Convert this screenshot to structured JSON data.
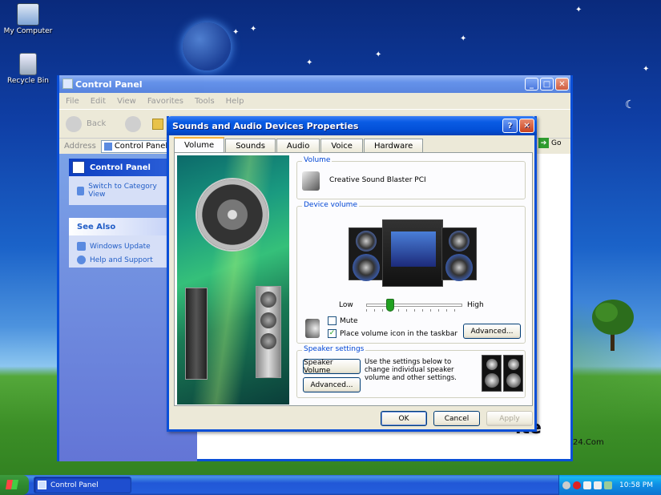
{
  "desktop": {
    "icons": [
      {
        "label": "My Computer"
      },
      {
        "label": "Recycle Bin"
      }
    ],
    "watermark": "ite",
    "watermark_sub": "24.Com"
  },
  "control_panel": {
    "title": "Control Panel",
    "menu": [
      "File",
      "Edit",
      "View",
      "Favorites",
      "Tools",
      "Help"
    ],
    "back_label": "Back",
    "address_label": "Address",
    "address_value": "Control Panel",
    "go_label": "Go",
    "left_panel": {
      "header": "Control Panel",
      "switch_link": "Switch to Category View",
      "see_also_header": "See Also",
      "links": [
        "Windows Update",
        "Help and Support"
      ]
    }
  },
  "dialog": {
    "title": "Sounds and Audio Devices Properties",
    "tabs": [
      "Volume",
      "Sounds",
      "Audio",
      "Voice",
      "Hardware"
    ],
    "active_tab": "Volume",
    "volume_group_label": "Volume",
    "device_name": "Creative Sound Blaster PCI",
    "device_volume_label": "Device volume",
    "slider_low": "Low",
    "slider_high": "High",
    "slider_level": 0.25,
    "mute_label": "Mute",
    "mute_checked": false,
    "taskbar_icon_label": "Place volume icon in the taskbar",
    "taskbar_icon_checked": true,
    "advanced_label": "Advanced...",
    "speaker_settings_label": "Speaker settings",
    "speaker_volume_button": "Speaker Volume",
    "speaker_desc": "Use the settings below to change individual speaker volume and other settings.",
    "speaker_advanced": "Advanced...",
    "ok": "OK",
    "cancel": "Cancel",
    "apply": "Apply"
  },
  "taskbar": {
    "task_label": "Control Panel",
    "clock": "10:58 PM"
  },
  "colors": {
    "xp_blue": "#0350d8",
    "link_blue": "#215dc6",
    "group_label": "#0046d5",
    "start_green": "#2f8a2f"
  }
}
